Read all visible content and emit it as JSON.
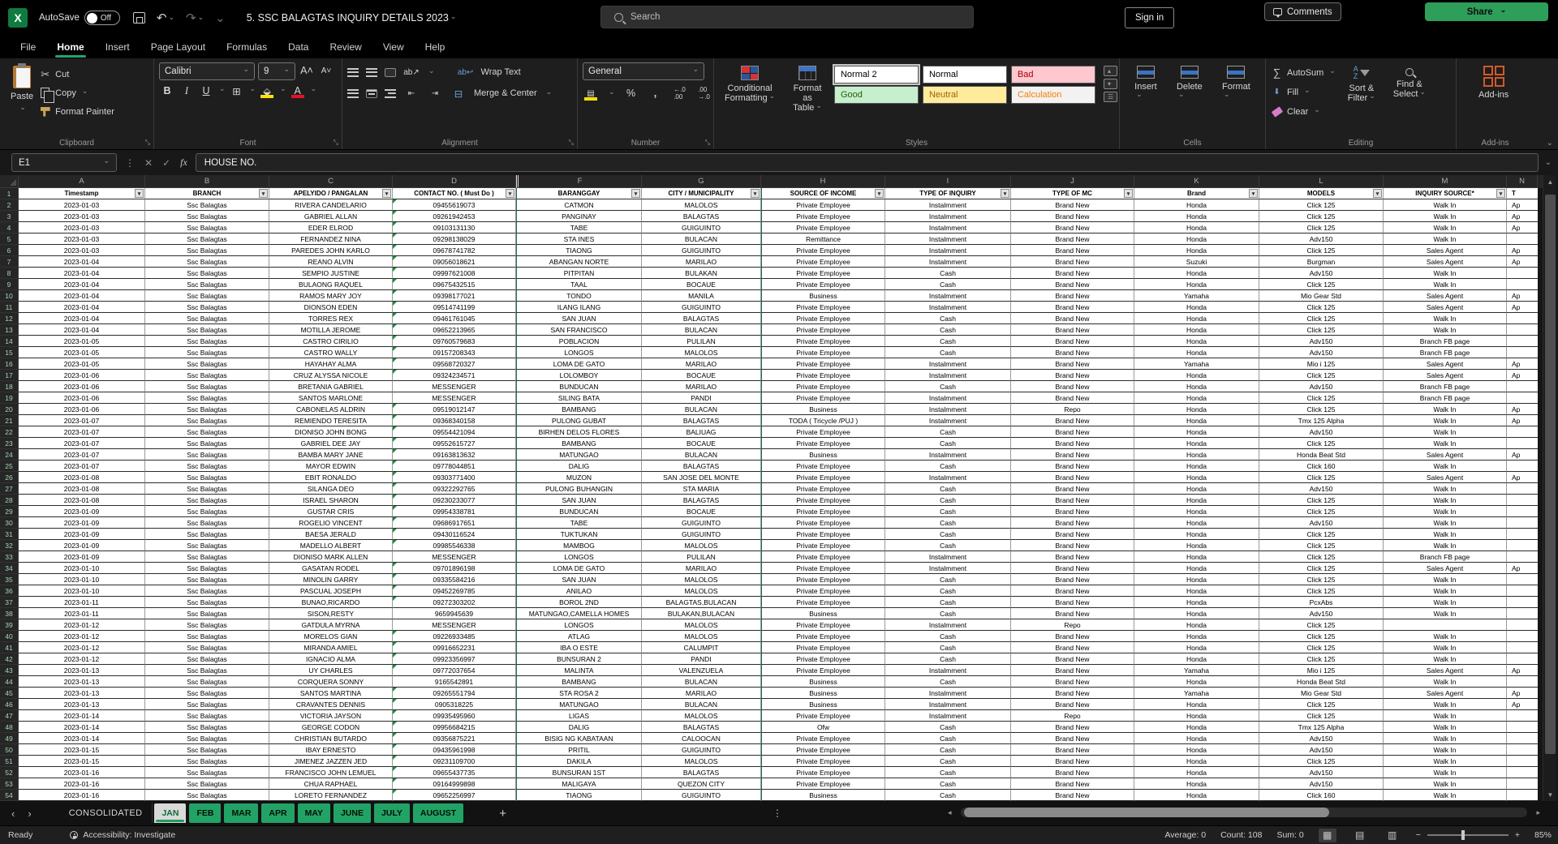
{
  "titlebar": {
    "app": "Excel",
    "autosave_label": "AutoSave",
    "autosave_state": "Off",
    "title": "5. SSC BALAGTAS INQUIRY DETAILS 2023",
    "search_placeholder": "Search",
    "sign_in": "Sign in"
  },
  "menu": {
    "tabs": [
      "File",
      "Home",
      "Insert",
      "Page Layout",
      "Formulas",
      "Data",
      "Review",
      "View",
      "Help"
    ],
    "active": "Home",
    "comments": "Comments",
    "share": "Share"
  },
  "ribbon": {
    "paste": "Paste",
    "cut": "Cut",
    "copy": "Copy",
    "format_painter": "Format Painter",
    "clipboard_group": "Clipboard",
    "font_name": "Calibri",
    "font_size": "9",
    "bold": "B",
    "italic": "I",
    "underline": "U",
    "font_group": "Font",
    "wrap_text": "Wrap Text",
    "merge_center": "Merge & Center",
    "alignment_group": "Alignment",
    "number_format": "General",
    "number_group": "Number",
    "conditional_line1": "Conditional",
    "conditional_line2": "Formatting",
    "format_table_line1": "Format as",
    "format_table_line2": "Table",
    "styles": [
      {
        "label": "Normal 2",
        "bg": "#ffffff",
        "fg": "#000000"
      },
      {
        "label": "Normal",
        "bg": "#ffffff",
        "fg": "#000000"
      },
      {
        "label": "Bad",
        "bg": "#ffc7ce",
        "fg": "#9c0006"
      },
      {
        "label": "Good",
        "bg": "#c6efce",
        "fg": "#276100"
      },
      {
        "label": "Neutral",
        "bg": "#ffeb9c",
        "fg": "#9c6500"
      },
      {
        "label": "Calculation",
        "bg": "#f2f2f2",
        "fg": "#fa7d00"
      }
    ],
    "styles_group": "Styles",
    "insert": "Insert",
    "delete": "Delete",
    "format": "Format",
    "cells_group": "Cells",
    "autosum": "AutoSum",
    "fill": "Fill",
    "clear": "Clear",
    "sort_filter_line1": "Sort &",
    "sort_filter_line2": "Filter",
    "find_select_line1": "Find &",
    "find_select_line2": "Select",
    "editing_group": "Editing",
    "addins": "Add-ins",
    "addins_group": "Add-ins"
  },
  "formula_bar": {
    "name_box": "E1",
    "fx": "fx",
    "content": "HOUSE NO."
  },
  "grid": {
    "col_letters": [
      "A",
      "B",
      "C",
      "D",
      "F",
      "G",
      "H",
      "I",
      "J",
      "K",
      "L",
      "M",
      "N"
    ],
    "headers": [
      "Timestamp",
      "BRANCH",
      "APELYIDO / PANGALAN",
      "CONTACT NO. ( Must Do )",
      "BARANGGAY",
      "CITY / MUNICIPALITY",
      "SOURCE OF INCOME",
      "TYPE OF INQUIRY",
      "TYPE OF MC",
      "Brand",
      "MODELS",
      "INQUIRY SOURCE*"
    ],
    "partial_header": "T",
    "rows": [
      [
        "2023-01-03",
        "Ssc Balagtas",
        "RIVERA CANDELARIO",
        "09455619073",
        "CATMON",
        "MALOLOS",
        "Private Employee",
        "Instalmment",
        "Brand New",
        "Honda",
        "Click 125",
        "Walk In",
        "Ap"
      ],
      [
        "2023-01-03",
        "Ssc Balagtas",
        "GABRIEL ALLAN",
        "09261942453",
        "PANGINAY",
        "BALAGTAS",
        "Private Employee",
        "Instalmment",
        "Brand New",
        "Honda",
        "Click 125",
        "Walk In",
        "Ap"
      ],
      [
        "2023-01-03",
        "Ssc Balagtas",
        "EDER ELROD",
        "09103131130",
        "TABE",
        "GUIGUINTO",
        "Private Employee",
        "Instalmment",
        "Brand New",
        "Honda",
        "Click 125",
        "Walk In",
        "Ap"
      ],
      [
        "2023-01-03",
        "Ssc Balagtas",
        "FERNANDEZ NINA",
        "09298138029",
        "STA INES",
        "BULACAN",
        "Remittance",
        "Instalmment",
        "Brand New",
        "Honda",
        "Adv150",
        "Walk In",
        ""
      ],
      [
        "2023-01-03",
        "Ssc Balagtas",
        "PAREDES JOHN KARLO",
        "09678741782",
        "TIAONG",
        "GUIGUINTO",
        "Private Employee",
        "Instalmment",
        "Brand New",
        "Honda",
        "Click 125",
        "Sales Agent",
        "Ap"
      ],
      [
        "2023-01-04",
        "Ssc Balagtas",
        "REANO ALVIN",
        "09056018621",
        "ABANGAN NORTE",
        "MARILAO",
        "Private Employee",
        "Instalmment",
        "Brand New",
        "Suzuki",
        "Burgman",
        "Sales Agent",
        "Ap"
      ],
      [
        "2023-01-04",
        "Ssc Balagtas",
        "SEMPIO JUSTINE",
        "09997621008",
        "PITPITAN",
        "BULAKAN",
        "Private Employee",
        "Cash",
        "Brand New",
        "Honda",
        "Adv150",
        "Walk In",
        ""
      ],
      [
        "2023-01-04",
        "Ssc Balagtas",
        "BULAONG RAQUEL",
        "09675432515",
        "TAAL",
        "BOCAUE",
        "Private Employee",
        "Cash",
        "Brand New",
        "Honda",
        "Click 125",
        "Walk In",
        ""
      ],
      [
        "2023-01-04",
        "Ssc Balagtas",
        "RAMOS MARY JOY",
        "09398177021",
        "TONDO",
        "MANILA",
        "Business",
        "Instalmment",
        "Brand New",
        "Yamaha",
        "Mio Gear Std",
        "Sales Agent",
        "Ap"
      ],
      [
        "2023-01-04",
        "Ssc Balagtas",
        "DIONSON EDEN",
        "09514741199",
        "ILANG ILANG",
        "GUIGUINTO",
        "Private Employee",
        "Instalmment",
        "Brand New",
        "Honda",
        "Click 125",
        "Sales Agent",
        "Ap"
      ],
      [
        "2023-01-04",
        "Ssc Balagtas",
        "TORRES REX",
        "09461761045",
        "SAN JUAN",
        "BALAGTAS",
        "Private Employee",
        "Cash",
        "Brand New",
        "Honda",
        "Click 125",
        "Walk In",
        ""
      ],
      [
        "2023-01-04",
        "Ssc Balagtas",
        "MOTILLA JEROME",
        "09652213965",
        "SAN FRANCISCO",
        "BULACAN",
        "Private Employee",
        "Cash",
        "Brand New",
        "Honda",
        "Click 125",
        "Walk In",
        ""
      ],
      [
        "2023-01-05",
        "Ssc Balagtas",
        "CASTRO CIRILIO",
        "09760579683",
        "POBLACION",
        "PULILAN",
        "Private Employee",
        "Cash",
        "Brand New",
        "Honda",
        "Adv150",
        "Branch FB page",
        ""
      ],
      [
        "2023-01-05",
        "Ssc Balagtas",
        "CASTRO WALLY",
        "09157208343",
        "LONGOS",
        "MALOLOS",
        "Private Employee",
        "Cash",
        "Brand New",
        "Honda",
        "Adv150",
        "Branch FB page",
        ""
      ],
      [
        "2023-01-05",
        "Ssc Balagtas",
        "HAYAHAY ALMA",
        "09568720327",
        "LOMA DE GATO",
        "MARILAO",
        "Private Employee",
        "Instalmment",
        "Brand New",
        "Yamaha",
        "Mio i 125",
        "Sales Agent",
        "Ap"
      ],
      [
        "2023-01-06",
        "Ssc Balagtas",
        "CRUZ ALYSSA NICOLE",
        "09324234571",
        "LOLOMBOY",
        "BOCAUE",
        "Private Employee",
        "Instalmment",
        "Brand New",
        "Honda",
        "Click 125",
        "Sales Agent",
        "Ap"
      ],
      [
        "2023-01-06",
        "Ssc Balagtas",
        "BRETANIA GABRIEL",
        "MESSENGER",
        "BUNDUCAN",
        "MARILAO",
        "Private Employee",
        "Cash",
        "Brand New",
        "Honda",
        "Adv150",
        "Branch FB page",
        ""
      ],
      [
        "2023-01-06",
        "Ssc Balagtas",
        "SANTOS MARLONE",
        "MESSENGER",
        "SILING BATA",
        "PANDI",
        "Private Employee",
        "Instalmment",
        "Brand New",
        "Honda",
        "Click 125",
        "Branch FB page",
        ""
      ],
      [
        "2023-01-06",
        "Ssc Balagtas",
        "CABONELAS ALDRIN",
        "09519012147",
        "BAMBANG",
        "BULACAN",
        "Business",
        "Instalmment",
        "Repo",
        "Honda",
        "Click 125",
        "Walk In",
        "Ap"
      ],
      [
        "2023-01-07",
        "Ssc Balagtas",
        "REMIENDO TERESITA",
        "09368340158",
        "PULONG GUBAT",
        "BALAGTAS",
        "TODA ( Tricycle /PUJ )",
        "Instalmment",
        "Brand New",
        "Honda",
        "Tmx 125 Alpha",
        "Walk In",
        "Ap"
      ],
      [
        "2023-01-07",
        "Ssc Balagtas",
        "DIONISO JOHN BONG",
        "09554421094",
        "BIRHEN DELOS FLORES",
        "BALIUAG",
        "Private Employee",
        "Cash",
        "Brand New",
        "Honda",
        "Adv150",
        "Walk In",
        ""
      ],
      [
        "2023-01-07",
        "Ssc Balagtas",
        "GABRIEL DEE JAY",
        "09552615727",
        "BAMBANG",
        "BOCAUE",
        "Private Employee",
        "Cash",
        "Brand New",
        "Honda",
        "Click 125",
        "Walk In",
        ""
      ],
      [
        "2023-01-07",
        "Ssc Balagtas",
        "BAMBA MARY JANE",
        "09163813632",
        "MATUNGAO",
        "BULACAN",
        "Business",
        "Instalmment",
        "Brand New",
        "Honda",
        "Honda Beat Std",
        "Sales Agent",
        "Ap"
      ],
      [
        "2023-01-07",
        "Ssc Balagtas",
        "MAYOR EDWIN",
        "09778044851",
        "DALIG",
        "BALAGTAS",
        "Private Employee",
        "Cash",
        "Brand New",
        "Honda",
        "Click 160",
        "Walk In",
        ""
      ],
      [
        "2023-01-08",
        "Ssc Balagtas",
        "EBIT RONALDO",
        "09303771400",
        "MUZON",
        "SAN JOSE DEL MONTE",
        "Private Employee",
        "Instalmment",
        "Brand New",
        "Honda",
        "Click 125",
        "Sales Agent",
        "Ap"
      ],
      [
        "2023-01-08",
        "Ssc Balagtas",
        "SILANGA DEO",
        "09322292765",
        "PULONG BUHANGIN",
        "STA MARIA",
        "Private Employee",
        "Cash",
        "Brand New",
        "Honda",
        "Adv150",
        "Walk In",
        ""
      ],
      [
        "2023-01-08",
        "Ssc Balagtas",
        "ISRAEL SHARON",
        "09230233077",
        "SAN JUAN",
        "BALAGTAS",
        "Private Employee",
        "Cash",
        "Brand New",
        "Honda",
        "Click 125",
        "Walk In",
        ""
      ],
      [
        "2023-01-09",
        "Ssc Balagtas",
        "GUSTAR CRIS",
        "09954338781",
        "BUNDUCAN",
        "BOCAUE",
        "Private Employee",
        "Cash",
        "Brand New",
        "Honda",
        "Click 125",
        "Walk In",
        ""
      ],
      [
        "2023-01-09",
        "Ssc Balagtas",
        "ROGELIO  VINCENT",
        "09686917651",
        "TABE",
        "GUIGUINTO",
        "Private Employee",
        "Cash",
        "Brand New",
        "Honda",
        "Adv150",
        "Walk In",
        ""
      ],
      [
        "2023-01-09",
        "Ssc Balagtas",
        "BAESA JERALD",
        "09430116524",
        "TUKTUKAN",
        "GUIGUINTO",
        "Private Employee",
        "Cash",
        "Brand New",
        "Honda",
        "Click 125",
        "Walk In",
        ""
      ],
      [
        "2023-01-09",
        "Ssc Balagtas",
        "MADELLO ALBERT",
        "09985546338",
        "MAMBOG",
        "MALOLOS",
        "Private Employee",
        "Cash",
        "Brand New",
        "Honda",
        "Click 125",
        "Walk In",
        ""
      ],
      [
        "2023-01-09",
        "Ssc Balagtas",
        "DIONISO MARK ALLEN",
        "MESSENGER",
        "LONGOS",
        "PULILAN",
        "Private Employee",
        "Instalmment",
        "Brand New",
        "Honda",
        "Click 125",
        "Branch FB page",
        ""
      ],
      [
        "2023-01-10",
        "Ssc Balagtas",
        "GASATAN RODEL",
        "09701896198",
        "LOMA DE GATO",
        "MARILAO",
        "Private Employee",
        "Instalmment",
        "Brand New",
        "Honda",
        "Click 125",
        "Sales Agent",
        "Ap"
      ],
      [
        "2023-01-10",
        "Ssc Balagtas",
        "MINOLIN GARRY",
        "09335584216",
        "SAN JUAN",
        "MALOLOS",
        "Private Employee",
        "Cash",
        "Brand New",
        "Honda",
        "Click 125",
        "Walk In",
        ""
      ],
      [
        "2023-01-10",
        "Ssc Balagtas",
        "PASCUAL JOSEPH",
        "09452269785",
        "ANILAO",
        "MALOLOS",
        "Private Employee",
        "Cash",
        "Brand New",
        "Honda",
        "Click 125",
        "Walk In",
        ""
      ],
      [
        "2023-01-11",
        "Ssc Balagtas",
        "BUNAO,RICARDO",
        "09272303202",
        "BOROL 2ND",
        "BALAGTAS,BULACAN",
        "Private Employee",
        "Cash",
        "Brand New",
        "Honda",
        "PcxAbs",
        "Walk In",
        ""
      ],
      [
        "2023-01-11",
        "Ssc Balagtas",
        "SISON,RESTY",
        "9659945639",
        "MATUNGAO,CAMELLA HOMES",
        "BULAKAN,BULACAN",
        "Business",
        "Cash",
        "Brand New",
        "Honda",
        "Adv150",
        "Walk In",
        ""
      ],
      [
        "2023-01-12",
        "Ssc Balagtas",
        "GATDULA MYRNA",
        "MESSENGER",
        "LONGOS",
        "MALOLOS",
        "Private Employee",
        "Instalmment",
        "Repo",
        "Honda",
        "Click 125",
        "",
        ""
      ],
      [
        "2023-01-12",
        "Ssc Balagtas",
        "MORELOS GIAN",
        "09226933485",
        "ATLAG",
        "MALOLOS",
        "Private Employee",
        "Cash",
        "Brand New",
        "Honda",
        "Click 125",
        "Walk In",
        ""
      ],
      [
        "2023-01-12",
        "Ssc Balagtas",
        "MIRANDA AMIEL",
        "09916652231",
        "IBA O ESTE",
        "CALUMPIT",
        "Private Employee",
        "Cash",
        "Brand New",
        "Honda",
        "Click 125",
        "Walk In",
        ""
      ],
      [
        "2023-01-12",
        "Ssc Balagtas",
        "IGNACIO ALMA",
        "09923356997",
        "BUNSURAN 2",
        "PANDI",
        "Private Employee",
        "Cash",
        "Brand New",
        "Honda",
        "Click 125",
        "Walk In",
        ""
      ],
      [
        "2023-01-13",
        "Ssc Balagtas",
        "UY CHARLES",
        "09772037654",
        "MALINTA",
        "VALENZUELA",
        "Private Employee",
        "Instalmment",
        "Brand New",
        "Yamaha",
        "Mio i 125",
        "Sales Agent",
        "Ap"
      ],
      [
        "2023-01-13",
        "Ssc Balagtas",
        "CORQUERA SONNY",
        "9165542891",
        "BAMBANG",
        "BULACAN",
        "Business",
        "Cash",
        "Brand New",
        "Honda",
        "Honda Beat Std",
        "Walk In",
        ""
      ],
      [
        "2023-01-13",
        "Ssc Balagtas",
        "SANTOS MARTINA",
        "09265551794",
        "STA ROSA 2",
        "MARILAO",
        "Business",
        "Instalmment",
        "Brand New",
        "Yamaha",
        "Mio Gear Std",
        "Sales Agent",
        "Ap"
      ],
      [
        "2023-01-13",
        "Ssc Balagtas",
        "CRAVANTES DENNIS",
        "0905318225",
        "MATUNGAO",
        "BULACAN",
        "Business",
        "Instalmment",
        "Brand New",
        "Honda",
        "Click 125",
        "Walk In",
        "Ap"
      ],
      [
        "2023-01-14",
        "Ssc Balagtas",
        "VICTORIA JAYSON",
        "09935495960",
        "LIGAS",
        "MALOLOS",
        "Private Employee",
        "Instalmment",
        "Repo",
        "Honda",
        "Click 125",
        "Walk In",
        ""
      ],
      [
        "2023-01-14",
        "Ssc Balagtas",
        "GEORGE CODON",
        "09956684215",
        "DALIG",
        "BALAGTAS",
        "Ofw",
        "Cash",
        "Brand New",
        "Honda",
        "Tmx 125 Alpha",
        "Walk In",
        ""
      ],
      [
        "2023-01-14",
        "Ssc Balagtas",
        "CHRISTIAN BUTARDO",
        "09356875221",
        "BISIG NG KABATAAN",
        "CALOOCAN",
        "Private Employee",
        "Cash",
        "Brand New",
        "Honda",
        "Adv150",
        "Walk In",
        ""
      ],
      [
        "2023-01-15",
        "Ssc Balagtas",
        "IBAY ERNESTO",
        "09435961998",
        "PRITIL",
        "GUIGUINTO",
        "Private Employee",
        "Cash",
        "Brand New",
        "Honda",
        "Adv150",
        "Walk In",
        ""
      ],
      [
        "2023-01-15",
        "Ssc Balagtas",
        "JIMENEZ JAZZEN JED",
        "09231109700",
        "DAKILA",
        "MALOLOS",
        "Private Employee",
        "Cash",
        "Brand New",
        "Honda",
        "Click 125",
        "Walk In",
        ""
      ],
      [
        "2023-01-16",
        "Ssc Balagtas",
        "FRANCISCO JOHN LEMUEL",
        "09655437735",
        "BUNSURAN 1ST",
        "BALAGTAS",
        "Private Employee",
        "Cash",
        "Brand New",
        "Honda",
        "Adv150",
        "Walk In",
        ""
      ],
      [
        "2023-01-16",
        "Ssc Balagtas",
        "CHUA RAPHAEL",
        "09164999898",
        "MALIGAYA",
        "QUEZON CITY",
        "Private Employee",
        "Cash",
        "Brand New",
        "Honda",
        "Adv150",
        "Walk In",
        ""
      ],
      [
        "2023-01-16",
        "Ssc Balagtas",
        "LORETO FERNANDEZ",
        "09652256997",
        "TIAONG",
        "GUIGUINTO",
        "Business",
        "Cash",
        "Brand New",
        "Honda",
        "Click 160",
        "Walk In",
        ""
      ]
    ]
  },
  "sheet_tabs": {
    "consolidated": "CONSOLIDATED",
    "months": [
      "JAN",
      "FEB",
      "MAR",
      "APR",
      "MAY",
      "JUNE",
      "JULY",
      "AUGUST"
    ],
    "active": "JAN",
    "add": "+"
  },
  "status_bar": {
    "ready": "Ready",
    "accessibility": "Accessibility: Investigate",
    "average": "Average: 0",
    "count": "Count: 108",
    "sum": "Sum: 0",
    "zoom": "85%"
  },
  "colors": {
    "accent_green": "#21a366",
    "excel_green": "#0f7b41",
    "tab_green": "#22a366",
    "marker_green": "#1e8e3e"
  }
}
